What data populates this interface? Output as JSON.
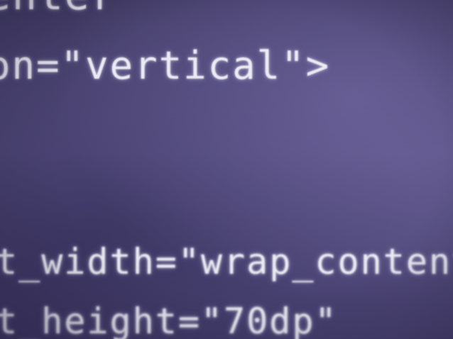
{
  "code_lines": [
    "enter",
    "on=\"vertical\">",
    "t_width=\"wrap_content",
    "t_height=\"70dp\""
  ],
  "colors": {
    "background": "#4d4670",
    "text": "#ecebf4"
  }
}
